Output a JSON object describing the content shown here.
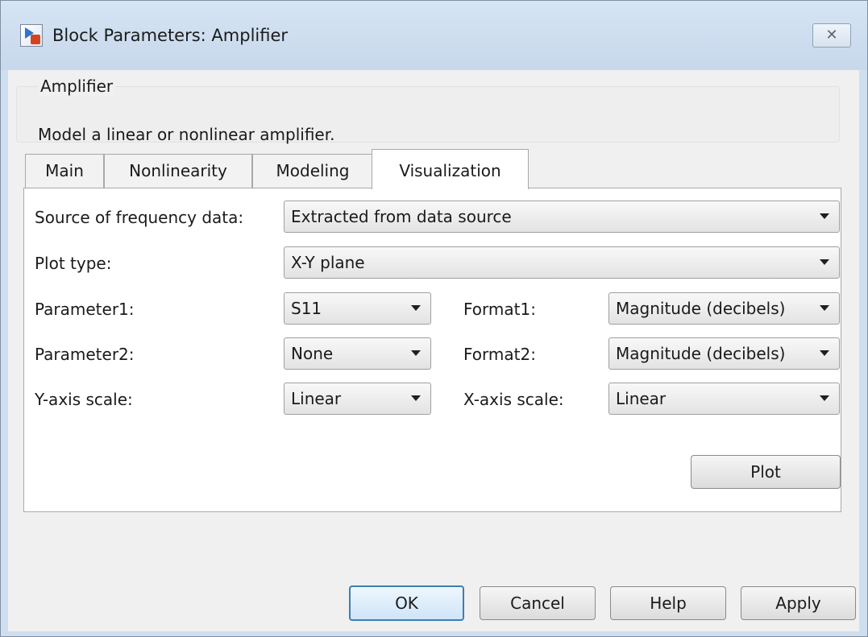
{
  "window": {
    "title": "Block Parameters: Amplifier",
    "close_glyph": "✕"
  },
  "description": {
    "group_title": "Amplifier",
    "text": "Model a linear or nonlinear amplifier."
  },
  "tabs": [
    {
      "label": "Main",
      "active": false
    },
    {
      "label": "Nonlinearity",
      "active": false
    },
    {
      "label": "Modeling",
      "active": false
    },
    {
      "label": "Visualization",
      "active": true
    }
  ],
  "visualization": {
    "source_label": "Source of frequency data:",
    "source_value": "Extracted from data source",
    "plot_type_label": "Plot type:",
    "plot_type_value": "X-Y plane",
    "parameter1_label": "Parameter1:",
    "parameter1_value": "S11",
    "format1_label": "Format1:",
    "format1_value": "Magnitude (decibels)",
    "parameter2_label": "Parameter2:",
    "parameter2_value": "None",
    "format2_label": "Format2:",
    "format2_value": "Magnitude (decibels)",
    "yscale_label": "Y-axis scale:",
    "yscale_value": "Linear",
    "xscale_label": "X-axis scale:",
    "xscale_value": "Linear",
    "plot_button": "Plot"
  },
  "buttons": {
    "ok": "OK",
    "cancel": "Cancel",
    "help": "Help",
    "apply": "Apply"
  },
  "colors": {
    "titlebar": "#cfdff0",
    "dialog_bg": "#f0f0f0",
    "default_button_border": "#3c7fb1"
  }
}
